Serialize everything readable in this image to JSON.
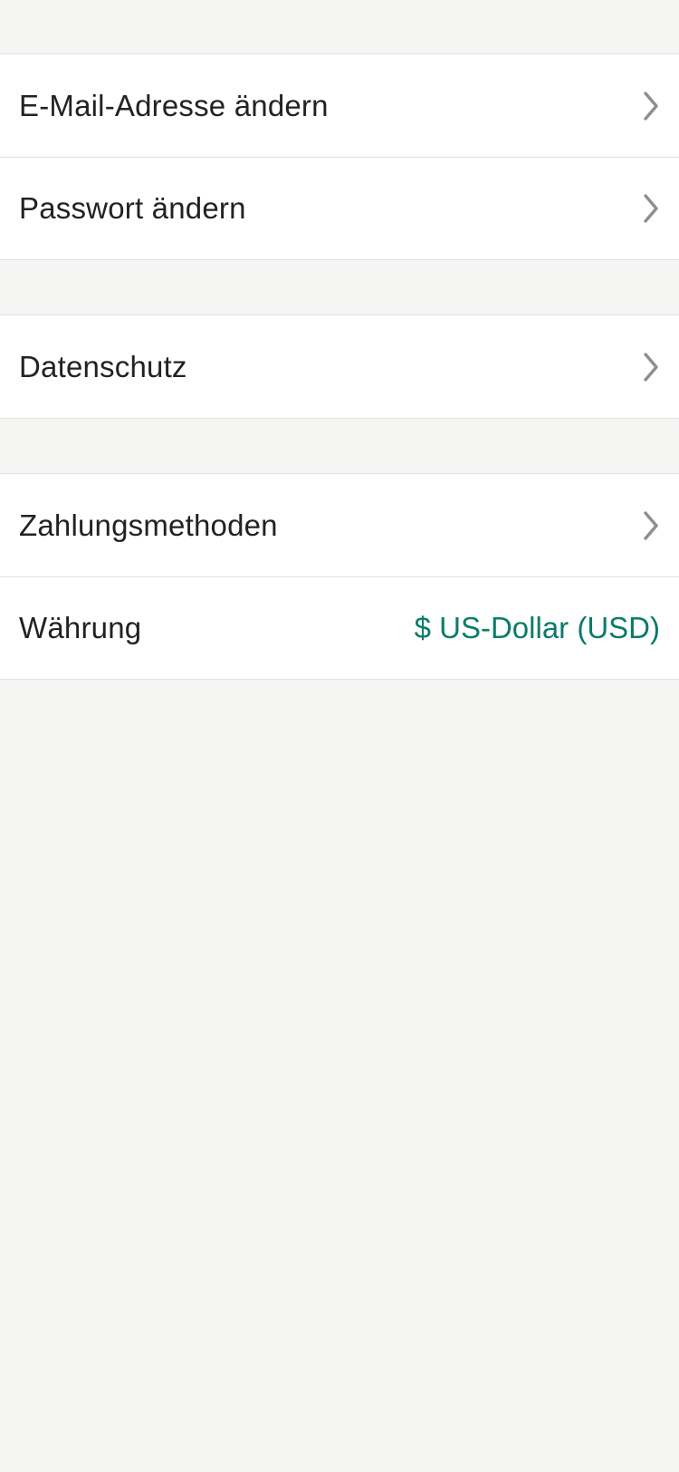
{
  "colors": {
    "background": "#f5f5f4",
    "row_background": "#ffffff",
    "separator": "#e2e2e2",
    "label_text": "#222222",
    "accent_value": "#0a7b6a",
    "chevron": "#8e8e8e"
  },
  "groups": [
    {
      "items": [
        {
          "label": "E-Mail-Adresse ändern",
          "icon": "chevron-right-icon"
        },
        {
          "label": "Passwort ändern",
          "icon": "chevron-right-icon"
        }
      ]
    },
    {
      "items": [
        {
          "label": "Datenschutz",
          "icon": "chevron-right-icon"
        }
      ]
    },
    {
      "items": [
        {
          "label": "Zahlungsmethoden",
          "icon": "chevron-right-icon"
        },
        {
          "label": "Währung",
          "value": "$ US-Dollar (USD)"
        }
      ]
    }
  ]
}
